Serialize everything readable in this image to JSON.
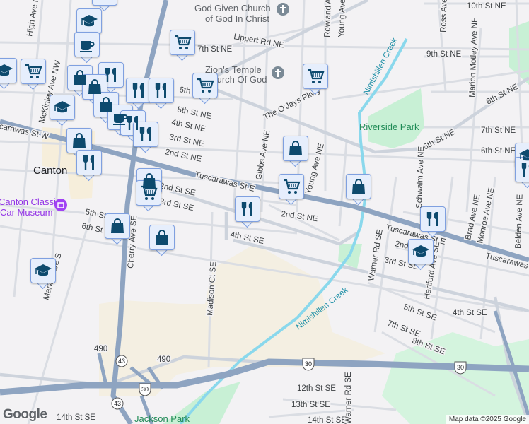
{
  "map": {
    "pois": {
      "church1_line1": "God Given Church",
      "church1_line2": "of God In Christ",
      "church2_line1": "Zion's Temple",
      "church2_line2": "Church Of God",
      "museum_line1": "Canton Classic",
      "museum_line2": "Car Museum"
    },
    "parks": {
      "riverside": "Riverside Park",
      "jackson": "Jackson Park"
    },
    "city": "Canton",
    "waterway": "Nimishillen Creek",
    "streets": {
      "high_ave": "High Ave NW",
      "mckinley": "McKinley Ave NW",
      "tusc_w": "Tuscarawas St W",
      "tusc_e": "Tuscarawas St E",
      "lippert": "Lippert Rd NE",
      "s7th": "7th St NE",
      "s6th": "6th St NE",
      "s5th": "5th St NE",
      "s4th": "4th St NE",
      "s3rd": "3rd St NE",
      "s2nd": "2nd St NE",
      "s3rd_se": "3rd St SE",
      "s2nd_se": "2nd St SE",
      "s4th_se": "4th St SE",
      "s5th_se": "5th St SE",
      "s6th_se": "6th St SE",
      "s7th_se": "7th St SE",
      "s8th_se": "8th St SE",
      "s12th_se": "12th St SE",
      "s13th_se": "13th St SE",
      "s14th_se": "14th St SE",
      "ojays": "The O'Jays Pkwy",
      "gibbs": "Gibbs Ave NE",
      "young": "Young Ave NE",
      "rowland": "Rowland Ave",
      "ross": "Ross Ave",
      "s10th": "10th St NE",
      "s9th": "9th St NE",
      "s8th": "8th St NE",
      "marion": "Marion Motley Ave NE",
      "schwalm": "Schwalm Ave NE",
      "warner": "Warner Rd SE",
      "hartford": "Hartford Ave SE",
      "brad": "Brad Ave NE",
      "monroe": "Monroe Ave NE",
      "belden": "Belden Ave NE",
      "madison": "Madison Ct SE",
      "cherry": "Cherry Ave SE",
      "market": "Market Ave S"
    },
    "shields": {
      "r43": "43",
      "r30": "30",
      "r490": "490"
    },
    "markers": [
      "shopping-bag",
      "graduation-cap",
      "coffee",
      "graduation-cap",
      "cart",
      "shopping-bag",
      "restaurant",
      "shopping-bag",
      "restaurant",
      "restaurant",
      "cart",
      "cart",
      "graduation-cap",
      "shopping-bag",
      "coffee",
      "restaurant",
      "restaurant",
      "shopping-bag",
      "restaurant",
      "shopping-bag",
      "cart",
      "restaurant",
      "shopping-bag",
      "cart",
      "cart",
      "shopping-bag",
      "restaurant",
      "graduation-cap",
      "graduation-cap",
      "restaurant",
      "shopping-bag",
      "shopping-bag",
      "graduation-cap"
    ],
    "attribution": "Map data ©2025 Google",
    "logo": "Google"
  }
}
